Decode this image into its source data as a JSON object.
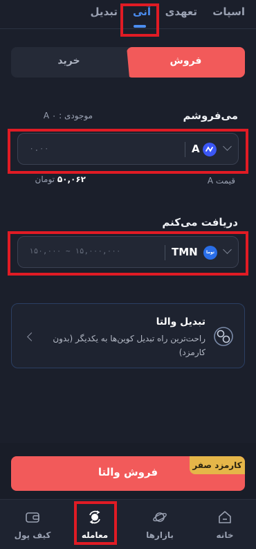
{
  "tabs": [
    {
      "label": "اسپات"
    },
    {
      "label": "تعهدی"
    },
    {
      "label": "آنی"
    },
    {
      "label": "تبدیل"
    }
  ],
  "toggle": {
    "sell_label": "فروش",
    "buy_label": "خرید"
  },
  "sell_section": {
    "label": "می‌فروشم",
    "balance_label": "موجودی :",
    "balance_value": "۰ A",
    "placeholder": "۰.۰۰",
    "currency": "A",
    "price_label": "قیمت A",
    "price_value": "۵۰,۰۶۲",
    "price_unit": "تومان"
  },
  "receive_section": {
    "label": "دریافت می‌کنم",
    "placeholder": "۱۵۰,۰۰۰ ~ ۱۵,۰۰۰,۰۰۰",
    "currency": "TMN",
    "coin_badge": "توما"
  },
  "convert_card": {
    "title": "تبدیل والتا",
    "description": "راحت‌ترین راه تبدیل کوین‌ها به یکدیگر (بدون کارمزد)"
  },
  "action": {
    "button_label": "فروش والتا",
    "badge": "کارمزد صفر"
  },
  "nav": [
    {
      "label": "خانه"
    },
    {
      "label": "بازارها"
    },
    {
      "label": "معامله"
    },
    {
      "label": "کیف پول"
    }
  ],
  "colors": {
    "accent": "#f25a5a",
    "active_tab": "#4b8df0",
    "fee_badge": "#e5b649"
  }
}
